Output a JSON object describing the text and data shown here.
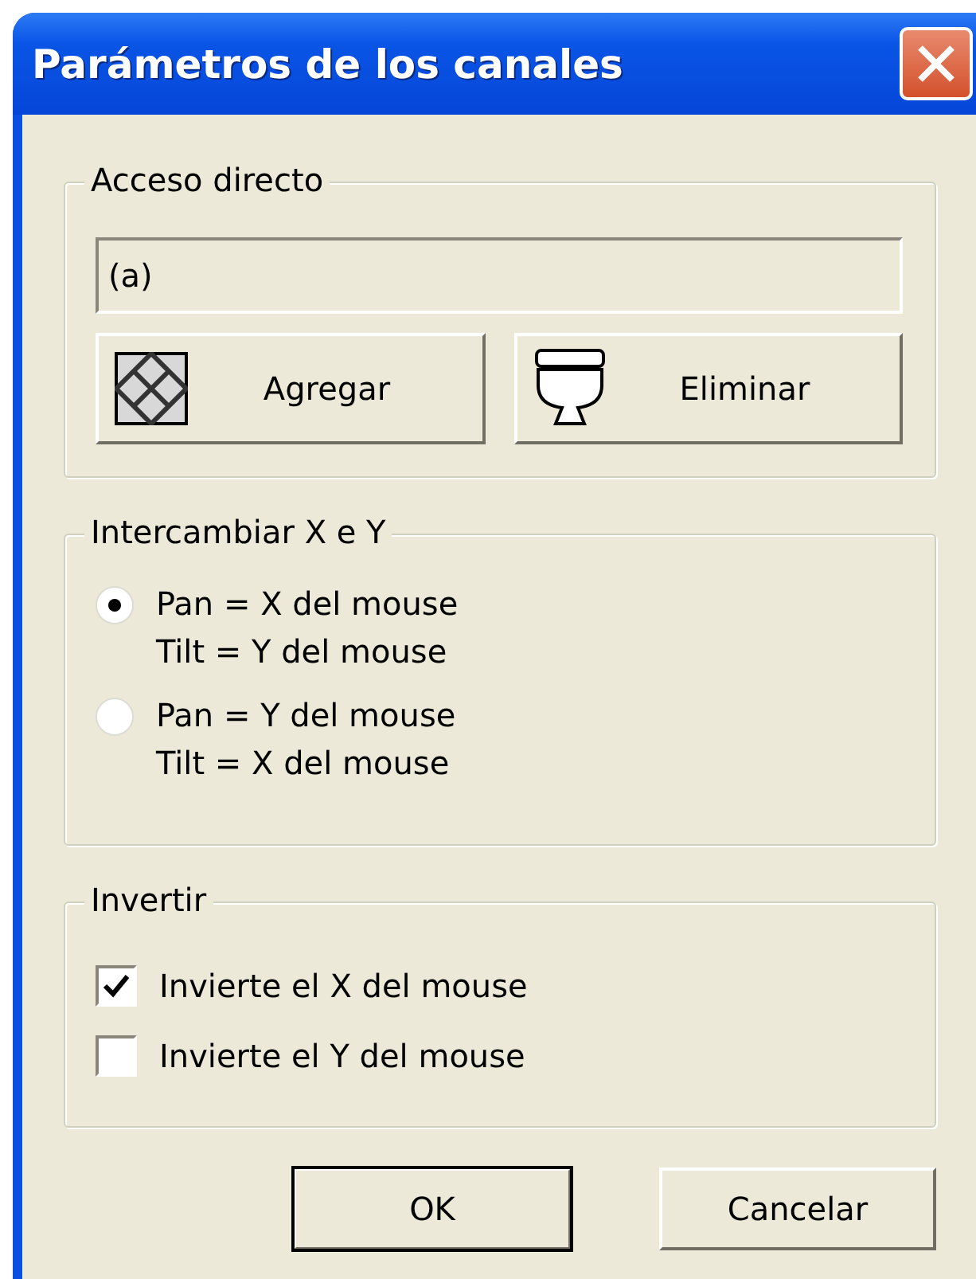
{
  "window": {
    "title": "Parámetros de los canales"
  },
  "shortcut_group": {
    "title": "Acceso directo",
    "field_value": "(a)",
    "buttons": [
      {
        "label": "Agregar",
        "kind": "tile"
      },
      {
        "label": "Eliminar",
        "kind": "toilet"
      }
    ]
  },
  "swap_group": {
    "title": "Intercambiar X e Y",
    "options": [
      {
        "lines": [
          "Pan = X del mouse",
          "Tilt = Y del mouse"
        ],
        "selected": true
      },
      {
        "lines": [
          "Pan = Y del mouse",
          "Tilt = X del mouse"
        ],
        "selected": false
      }
    ]
  },
  "invert_group": {
    "title": "Invertir",
    "options": [
      {
        "label": "Invierte el X del mouse",
        "checked": true
      },
      {
        "label": "Invierte el Y del mouse",
        "checked": false
      }
    ]
  },
  "buttons": [
    {
      "label": "OK",
      "default": true
    },
    {
      "label": "Cancelar",
      "default": false
    }
  ]
}
